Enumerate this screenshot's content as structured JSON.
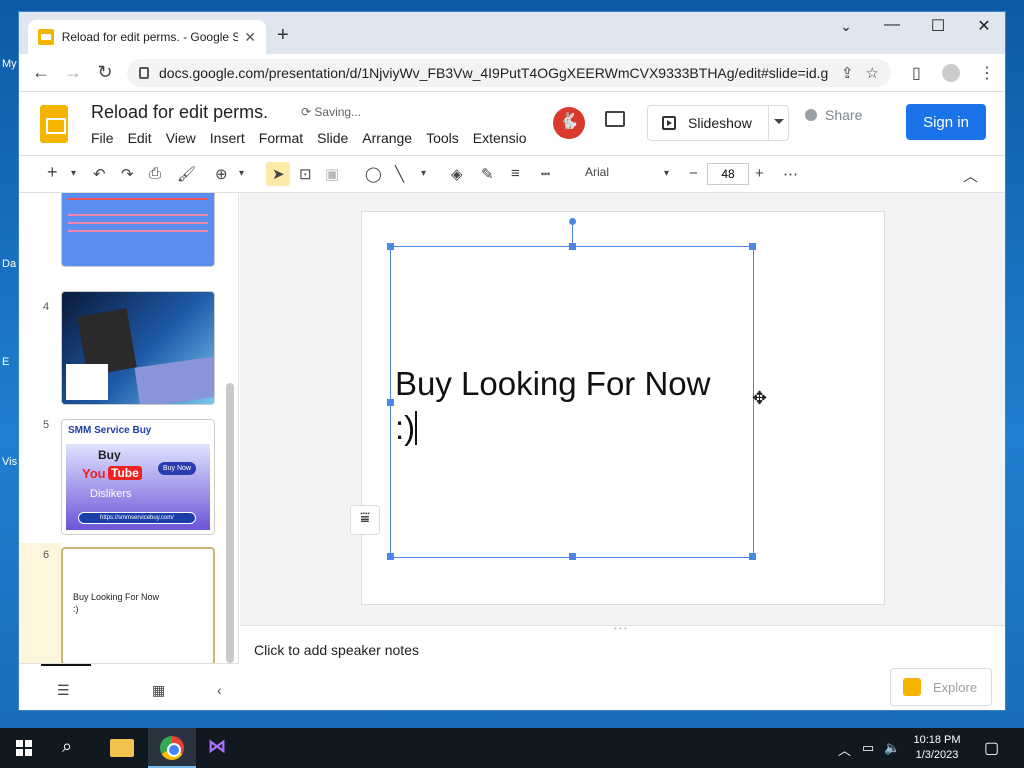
{
  "desktop": {
    "labels": [
      "My",
      "Da",
      "E",
      "Vis"
    ]
  },
  "browser": {
    "tab_title": "Reload for edit perms. - Google S",
    "tab_close": "✕",
    "new_tab": "+",
    "minimize": "—",
    "maximize": "☐",
    "close": "✕",
    "back": "←",
    "forward": "→",
    "reload": "↻",
    "url": "docs.google.com/presentation/d/1NjviyWv_FB3Vw_4I9PutT4OGgXEERWmCVX9333BTHAg/edit#slide=id.g..."
  },
  "app": {
    "doc_title": "Reload for edit perms.",
    "saving": "Saving...",
    "menu": [
      "File",
      "Edit",
      "View",
      "Insert",
      "Format",
      "Slide",
      "Arrange",
      "Tools",
      "Extensio"
    ],
    "slideshow_label": "Slideshow",
    "share_label": "Share",
    "signin_label": "Sign in",
    "font_name": "Arial",
    "font_size": "48"
  },
  "filmstrip": {
    "slides": [
      {
        "number": "",
        "caption": ""
      },
      {
        "number": "4",
        "caption": ""
      },
      {
        "number": "5",
        "caption": "SMM Service Buy"
      },
      {
        "number": "6",
        "caption": "Buy Looking For Now\n:)"
      }
    ],
    "slide5": {
      "brand": "SMM Service Buy",
      "buy": "Buy",
      "you": "You",
      "tube": "Tube",
      "dislikers": "Dislikers",
      "url": "https://smmservicebuy.com/",
      "buy_now": "Buy Now"
    },
    "slide6": {
      "line1": "Buy Looking For Now",
      "line2": ":)"
    }
  },
  "canvas": {
    "text_line1": "Buy Looking For Now",
    "text_line2": ":)"
  },
  "notes": {
    "placeholder": "Click to add speaker notes",
    "explore_label": "Explore"
  },
  "taskbar": {
    "time": "10:18 PM",
    "date": "1/3/2023"
  },
  "colors": {
    "accent_blue": "#1a73e8",
    "slides_yellow": "#f4b400",
    "selection_blue": "#4a86e8"
  }
}
